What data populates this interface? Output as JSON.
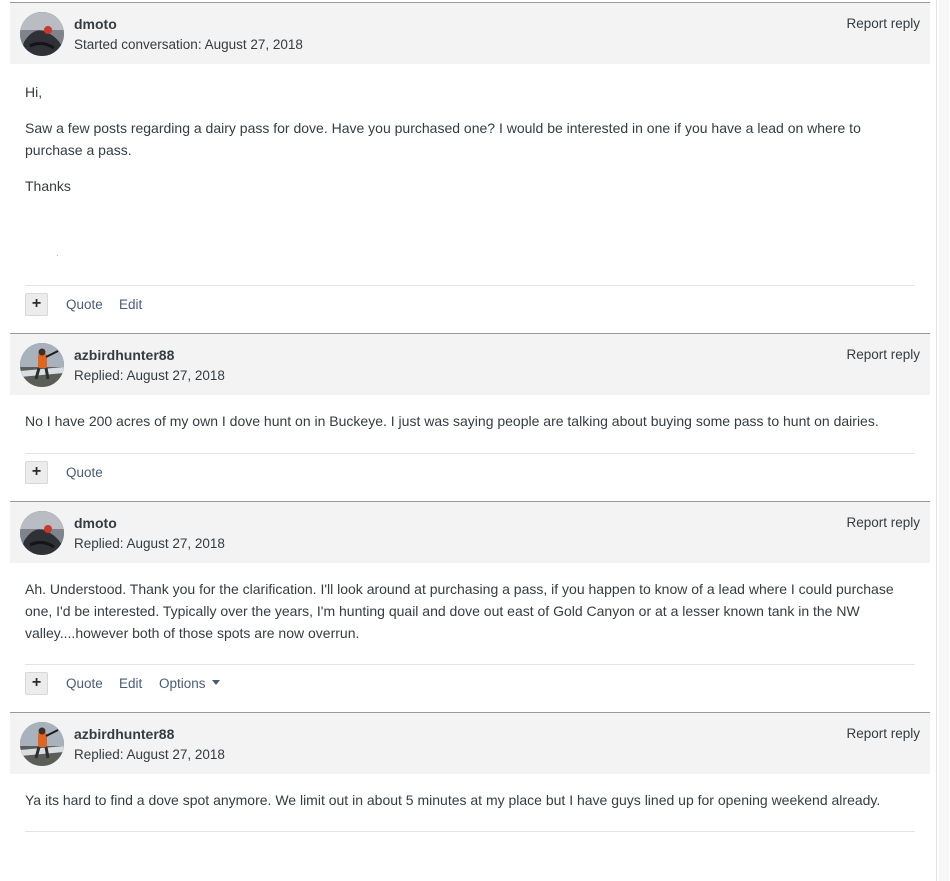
{
  "posts": [
    {
      "author": "dmoto",
      "date": "Started conversation: August 27, 2018",
      "report": "Report reply",
      "avatar": "dmoto-avatar",
      "body": [
        "Hi,",
        "Saw a few posts regarding a dairy pass for dove. Have you purchased one? I would be interested in one if you have a lead on where to purchase a pass.",
        "Thanks"
      ],
      "actions": {
        "plus": "+",
        "quote": "Quote",
        "edit": "Edit"
      }
    },
    {
      "author": "azbirdhunter88",
      "date": "Replied: August 27, 2018",
      "report": "Report reply",
      "avatar": "azbirdhunter88-avatar",
      "body": [
        "No I have 200 acres of my own I dove hunt on in Buckeye. I just was saying people are talking about buying some pass to hunt on dairies."
      ],
      "actions": {
        "plus": "+",
        "quote": "Quote"
      }
    },
    {
      "author": "dmoto",
      "date": "Replied: August 27, 2018",
      "report": "Report reply",
      "avatar": "dmoto-avatar",
      "body": [
        "Ah. Understood. Thank you for the clarification. I'll look around at purchasing a pass, if you happen to know of a lead where I could purchase one, I'd be interested. Typically over the years, I'm hunting quail and dove out east of Gold Canyon or at a lesser known tank in the NW valley....however both of those spots are now overrun."
      ],
      "actions": {
        "plus": "+",
        "quote": "Quote",
        "edit": "Edit",
        "options": "Options"
      }
    },
    {
      "author": "azbirdhunter88",
      "date": "Replied: August 27, 2018",
      "report": "Report reply",
      "avatar": "azbirdhunter88-avatar",
      "body": [
        "Ya its hard to find a dove spot anymore. We limit out in about 5 minutes at my place but I have guys lined up for opening weekend already."
      ]
    }
  ],
  "colors": {
    "link": "#4a5b7c",
    "header_bg": "#f3f3f3",
    "text": "#353c41"
  }
}
